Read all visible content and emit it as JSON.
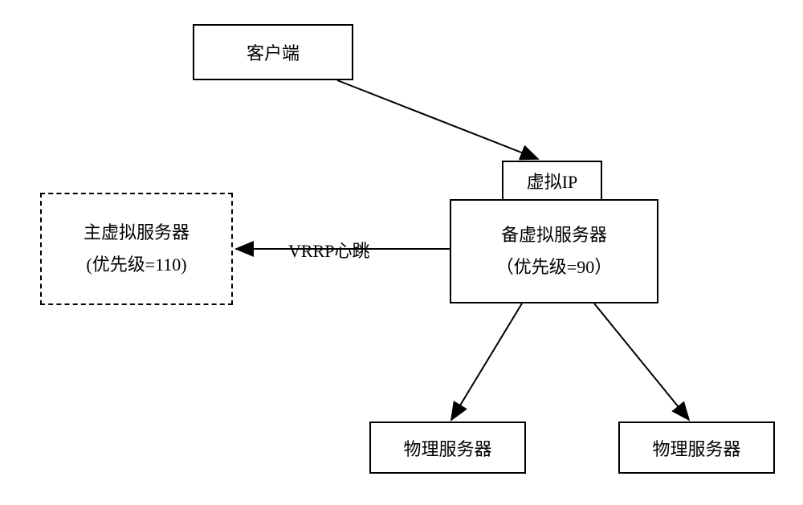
{
  "diagram": {
    "client": "客户端",
    "virtual_ip": "虚拟IP",
    "master_server_line1": "主虚拟服务器",
    "master_server_line2": "(优先级=110)",
    "backup_server_line1": "备虚拟服务器",
    "backup_server_line2": "（优先级=90）",
    "heartbeat_label": "VRRP心跳",
    "physical_server_left": "物理服务器",
    "physical_server_right": "物理服务器"
  },
  "chart_data": {
    "type": "diagram",
    "nodes": [
      {
        "id": "client",
        "label": "客户端",
        "style": "solid"
      },
      {
        "id": "virtual_ip",
        "label": "虚拟IP",
        "style": "solid"
      },
      {
        "id": "master",
        "label": "主虚拟服务器 (优先级=110)",
        "style": "dashed",
        "priority": 110
      },
      {
        "id": "backup",
        "label": "备虚拟服务器 （优先级=90）",
        "style": "solid",
        "priority": 90
      },
      {
        "id": "phys1",
        "label": "物理服务器",
        "style": "solid"
      },
      {
        "id": "phys2",
        "label": "物理服务器",
        "style": "solid"
      }
    ],
    "edges": [
      {
        "from": "client",
        "to": "virtual_ip",
        "label": ""
      },
      {
        "from": "backup",
        "to": "master",
        "label": "VRRP心跳"
      },
      {
        "from": "backup",
        "to": "phys1",
        "label": ""
      },
      {
        "from": "backup",
        "to": "phys2",
        "label": ""
      }
    ],
    "note": "virtual_ip box is attached to / overlaps the top of the backup server box"
  }
}
